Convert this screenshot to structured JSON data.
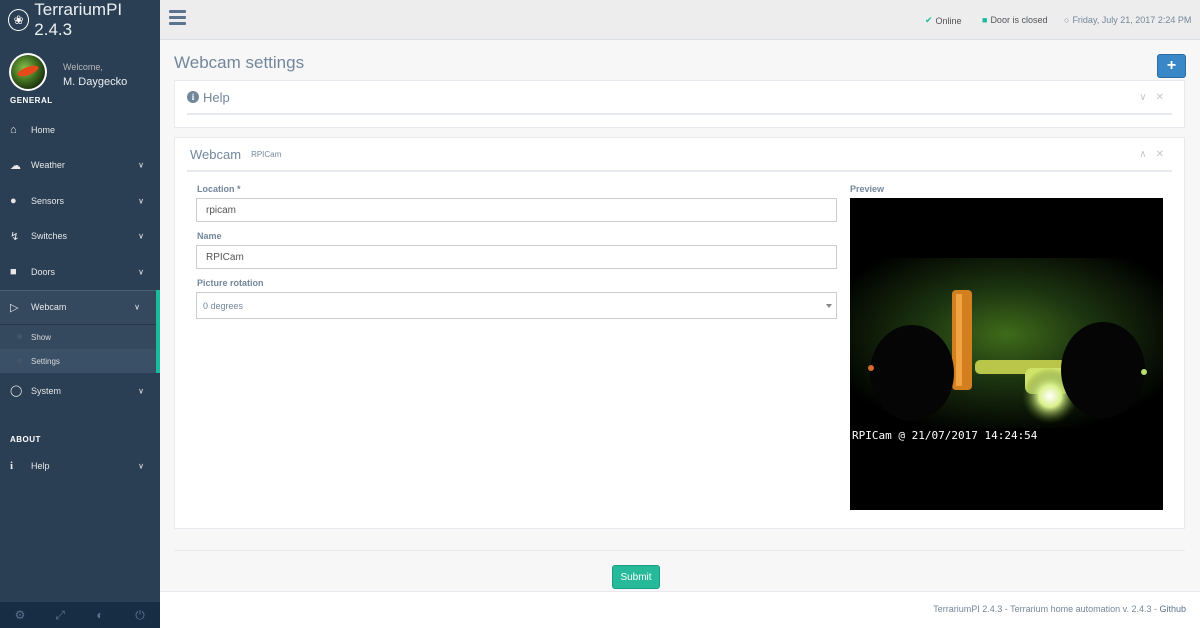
{
  "app": {
    "title": "TerrariumPI 2.4.3"
  },
  "profile": {
    "welcome": "Welcome,",
    "name": "M. Daygecko"
  },
  "sidebar": {
    "general_title": "GENERAL",
    "items": [
      {
        "label": "Home",
        "icon": "home-icon"
      },
      {
        "label": "Weather",
        "icon": "cloud-icon"
      },
      {
        "label": "Sensors",
        "icon": "droplet-icon"
      },
      {
        "label": "Switches",
        "icon": "bolt-icon"
      },
      {
        "label": "Doors",
        "icon": "lock-icon"
      },
      {
        "label": "Webcam",
        "icon": "video-camera-icon"
      },
      {
        "label": "System",
        "icon": "lightbulb-icon"
      }
    ],
    "webcam_children": [
      {
        "label": "Show"
      },
      {
        "label": "Settings"
      }
    ],
    "about_title": "ABOUT",
    "about_items": [
      {
        "label": "Help",
        "icon": "info-icon"
      }
    ]
  },
  "topbar": {
    "online": "Online",
    "door": "Door is closed",
    "datetime": "Friday, July 21, 2017 2:24 PM"
  },
  "page": {
    "title": "Webcam settings",
    "add_label": "+"
  },
  "help_panel": {
    "title": "Help"
  },
  "webcam_panel": {
    "title": "Webcam",
    "subtitle": "RPICam",
    "location_label": "Location *",
    "location_value": "rpicam",
    "name_label": "Name",
    "name_value": "RPICam",
    "rotation_label": "Picture rotation",
    "rotation_value": "0 degrees",
    "preview_label": "Preview",
    "preview_caption": "RPICam @ 21/07/2017 14:24:54"
  },
  "actions": {
    "submit": "Submit"
  },
  "footer": {
    "app": "TerrariumPI 2.4.3",
    "desc": " - Terrarium home automation v. 2.4.3 - ",
    "link": "Github"
  },
  "colors": {
    "sidebar_bg": "#2A3F54",
    "accent": "#1ABB9C",
    "submit": "#26B99A",
    "primary": "#3A87C8",
    "online": "#1ABB9C",
    "door_closed": "#1ABB9C"
  }
}
